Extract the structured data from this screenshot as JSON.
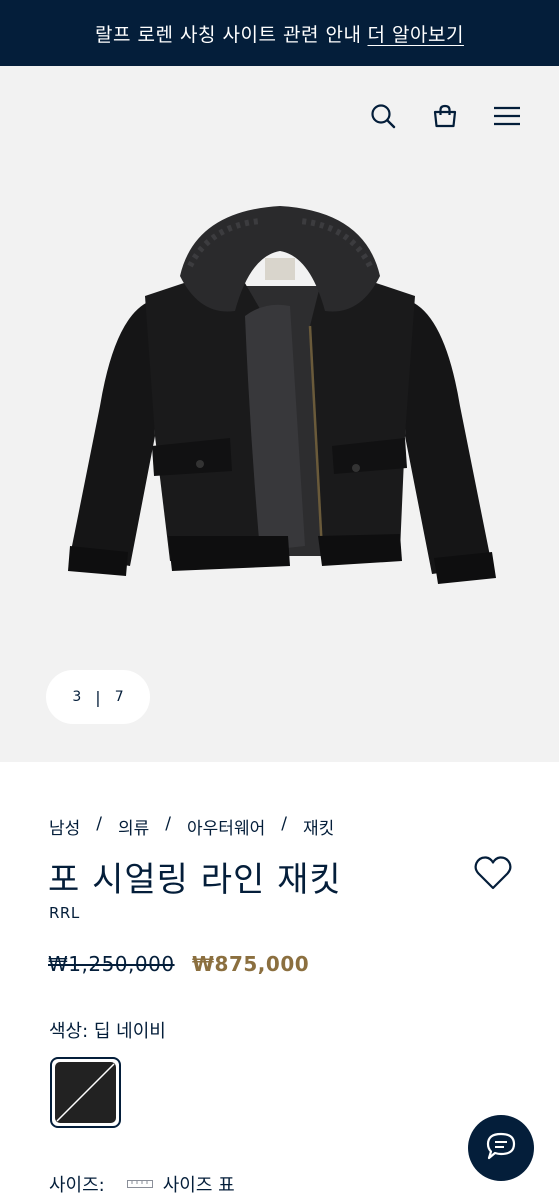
{
  "banner": {
    "text": "랄프 로렌 사칭 사이트 관련 안내",
    "link": "더 알아보기"
  },
  "header": {
    "icons": [
      "search-icon",
      "shopping-bag-icon",
      "menu-icon"
    ]
  },
  "gallery": {
    "current": "3",
    "separator": "|",
    "total": "7"
  },
  "breadcrumb": [
    "남성",
    "의류",
    "아우터웨어",
    "재킷"
  ],
  "product": {
    "title": "포 시얼링 라인 재킷",
    "brand": "RRL",
    "price_original": "₩1,250,000",
    "price_sale": "₩875,000",
    "color_label": "색상: 딥 네이비",
    "size_label": "사이즈:",
    "size_chart": "사이즈 표"
  },
  "colors": {
    "brand_navy": "#041e3a",
    "sale_gold": "#8b6f3f",
    "hero_bg": "#f2f2f2"
  }
}
